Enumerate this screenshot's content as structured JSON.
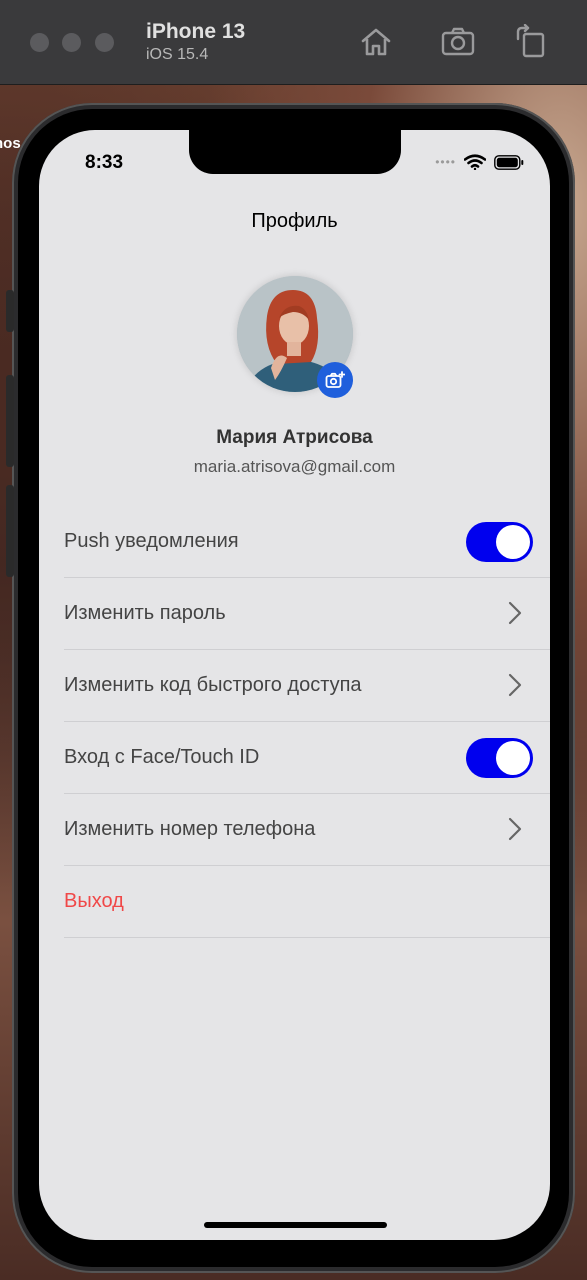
{
  "simulator": {
    "device_name": "iPhone 13",
    "os_version": "iOS 15.4"
  },
  "wallpaper_text": "nos",
  "status_bar": {
    "time": "8:33"
  },
  "nav": {
    "title": "Профиль"
  },
  "profile": {
    "name": "Мария Атрисова",
    "email": "maria.atrisova@gmail.com"
  },
  "settings": {
    "push": {
      "label": "Push уведомления",
      "enabled": true
    },
    "change_password": {
      "label": "Изменить пароль"
    },
    "change_quick_code": {
      "label": "Изменить код быстрого доступа"
    },
    "face_touch": {
      "label": "Вход с Face/Touch ID",
      "enabled": true
    },
    "change_phone": {
      "label": "Изменить номер телефона"
    },
    "logout": {
      "label": "Выход"
    }
  },
  "colors": {
    "toggle_on": "#0000ee",
    "camera_button": "#1f5fdc",
    "danger": "#f04848",
    "screen_bg": "#e5e5e7"
  },
  "icons": [
    "home-icon",
    "screenshot-icon",
    "rotate-icon",
    "wifi-icon",
    "battery-icon",
    "camera-plus-icon",
    "chevron-right-icon"
  ]
}
